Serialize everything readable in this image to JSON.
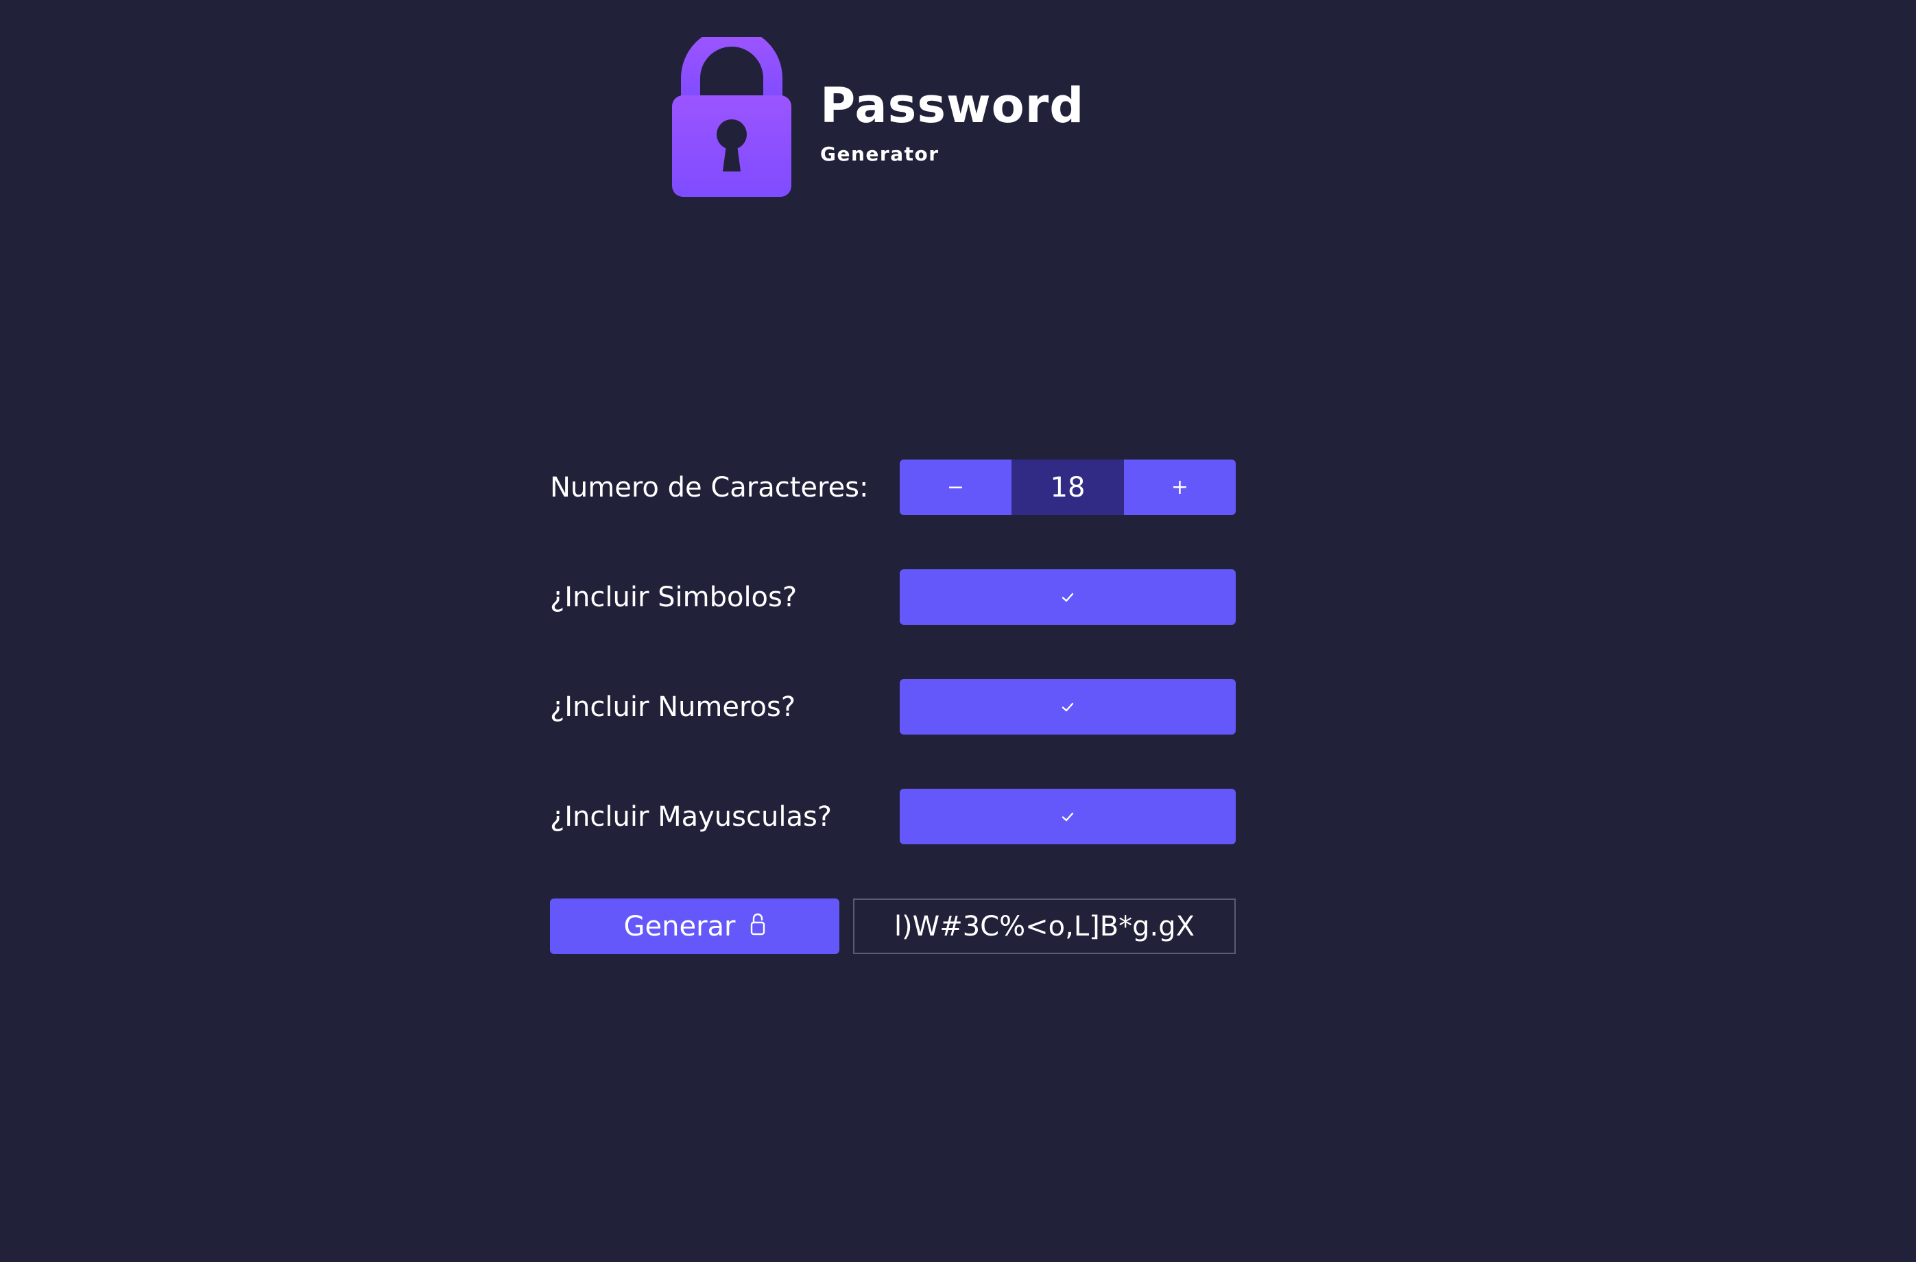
{
  "brand": {
    "title": "Password",
    "subtitle": "Generator",
    "logo_icon": "lock-icon",
    "accent_color": "#8a4fff"
  },
  "form": {
    "length": {
      "label": "Numero de Caracteres:",
      "decrement_label": "−",
      "increment_label": "+",
      "value": "18"
    },
    "options": [
      {
        "label": "¿Incluir Simbolos?",
        "checked": true,
        "icon": "check-icon"
      },
      {
        "label": "¿Incluir Numeros?",
        "checked": true,
        "icon": "check-icon"
      },
      {
        "label": "¿Incluir Mayusculas?",
        "checked": true,
        "icon": "check-icon"
      }
    ],
    "generate": {
      "label": "Generar",
      "icon": "unlock-icon"
    },
    "output": {
      "value": "l)W#3C%<o,L]B*g.gX"
    }
  },
  "colors": {
    "background": "#21213a",
    "button": "#6558fa",
    "stepper_value_bg": "#312b85"
  }
}
